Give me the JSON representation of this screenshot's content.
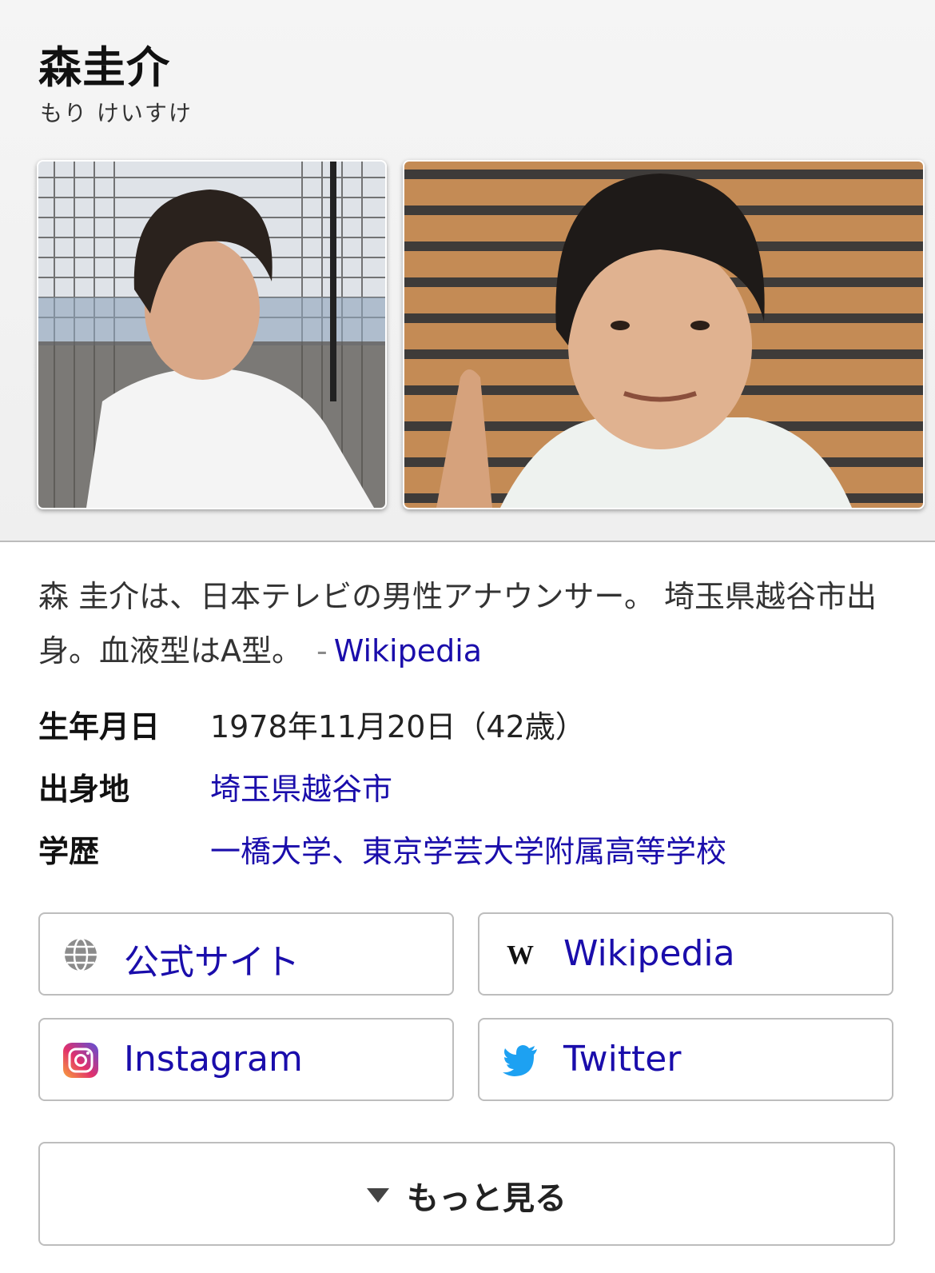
{
  "header": {
    "title": "森圭介",
    "reading": "もり けいすけ"
  },
  "photos": [
    {
      "name": "photo-1",
      "icon": "portrait-photo"
    },
    {
      "name": "photo-2",
      "icon": "portrait-photo"
    }
  ],
  "description": {
    "text_line": "森 圭介は、日本テレビの男性アナウンサー。 埼玉県越谷市出身。血液型はA型。",
    "separator": "-",
    "source": "Wikipedia"
  },
  "facts": [
    {
      "key": "生年月日",
      "value": "1978年11月20日（42歳）",
      "link": false
    },
    {
      "key": "出身地",
      "value": "埼玉県越谷市",
      "link": true
    },
    {
      "key": "学歴",
      "value": "一橋大学、東京学芸大学附属高等学校",
      "link": true
    }
  ],
  "links": {
    "official": {
      "label": "公式サイト",
      "icon": "globe-icon"
    },
    "wikipedia": {
      "label": "Wikipedia",
      "icon": "wikipedia-icon"
    },
    "instagram": {
      "label": "Instagram",
      "icon": "instagram-icon"
    },
    "twitter": {
      "label": "Twitter",
      "icon": "twitter-icon"
    }
  },
  "more": {
    "label": "もっと見る",
    "icon": "triangle-down-icon"
  },
  "colors": {
    "link": "#1a0dab",
    "twitter": "#1da1f2",
    "instagram": "#c13584"
  }
}
